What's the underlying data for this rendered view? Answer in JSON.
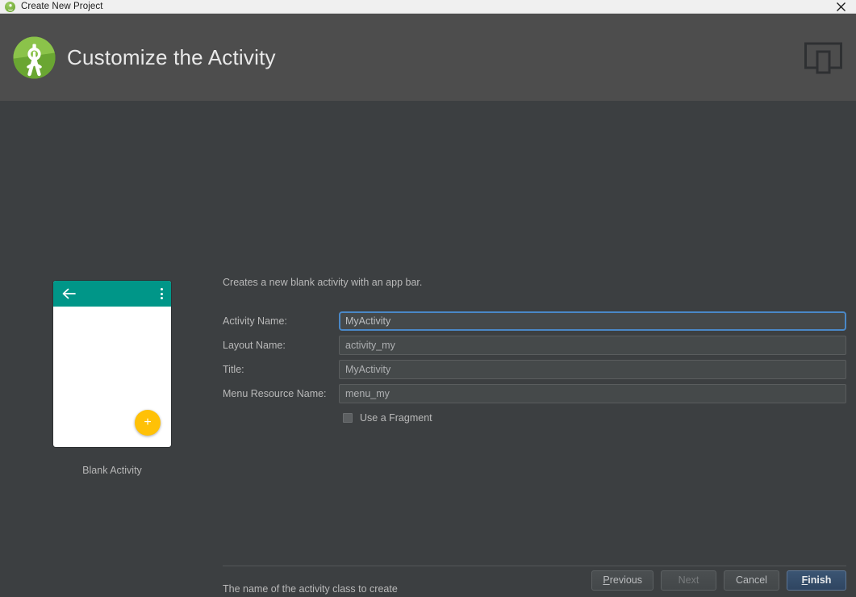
{
  "window": {
    "title": "Create New Project",
    "icon": "android-studio-icon",
    "close_icon": "close-icon"
  },
  "header": {
    "title": "Customize the Activity",
    "logo_icon": "android-studio-logo",
    "device_icon": "device-preview-icon"
  },
  "preview": {
    "caption": "Blank Activity",
    "back_icon": "back-arrow-icon",
    "overflow_icon": "overflow-menu-icon",
    "fab_icon": "add-icon",
    "fab_glyph": "+",
    "appbar_color": "#009688",
    "fab_color": "#ffc107"
  },
  "main": {
    "description": "Creates a new blank activity with an app bar.",
    "fields": [
      {
        "label": "Activity Name:",
        "value": "MyActivity",
        "focused": true
      },
      {
        "label": "Layout Name:",
        "value": "activity_my",
        "focused": false
      },
      {
        "label": "Title:",
        "value": "MyActivity",
        "focused": false
      },
      {
        "label": "Menu Resource Name:",
        "value": "menu_my",
        "focused": false
      }
    ],
    "checkbox": {
      "label": "Use a Fragment",
      "checked": false
    },
    "hint": "The name of the activity class to create"
  },
  "footer": {
    "buttons": [
      {
        "label": "Previous",
        "mnemonic": "P",
        "rest": "revious",
        "state": "enabled",
        "default": false
      },
      {
        "label": "Next",
        "mnemonic": "",
        "rest": "Next",
        "state": "disabled",
        "default": false
      },
      {
        "label": "Cancel",
        "mnemonic": "",
        "rest": "Cancel",
        "state": "enabled",
        "default": false
      },
      {
        "label": "Finish",
        "mnemonic": "F",
        "rest": "inish",
        "state": "enabled",
        "default": true
      }
    ]
  },
  "colors": {
    "titlebar_bg": "#f0f0f0",
    "header_bg": "#4d4d4d",
    "body_bg": "#3c3f41",
    "accent_focus": "#4a88c7",
    "default_button": "#3b5573"
  }
}
